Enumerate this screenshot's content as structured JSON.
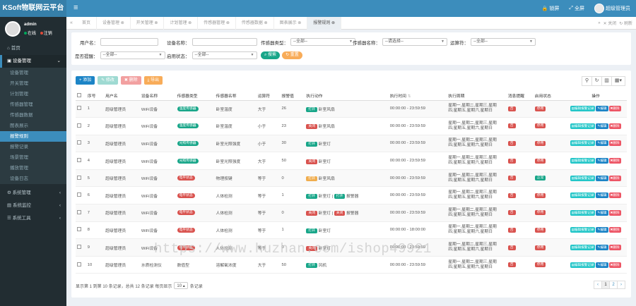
{
  "colors": {
    "brand": "#367fa9",
    "topbar": "#3c8dbc",
    "sidebar": "#222d32",
    "success": "#00a65a",
    "danger": "#dd4b39",
    "warning": "#f39c12",
    "info": "#00c0ef",
    "primary": "#3c8dbc",
    "teal": "#26a69a",
    "pill_green": "#18a689",
    "pill_red": "#d9534f",
    "pill_orange": "#f0ad4e",
    "cyan_btn": "#23c6c8",
    "blue_btn": "#1c84c6"
  },
  "header": {
    "app_title": "KSoft物联网云平台",
    "lock": "锁屏",
    "fullscreen": "全屏",
    "user": "超级管理员"
  },
  "user": {
    "name": "admin",
    "online": "在线",
    "logout": "注销"
  },
  "sidebar": {
    "home": "首页",
    "device_mgmt": "设备管理",
    "sub_items": [
      "设备管理",
      "开关管理",
      "计划管理",
      "传感器管理",
      "传感器数据",
      "图表展示",
      "报警规则",
      "报警记录",
      "场景管理",
      "播放管理",
      "设备日志"
    ],
    "groups": [
      "系统管理",
      "系统监控",
      "系统工具"
    ]
  },
  "tabs": [
    "首页",
    "设备管理",
    "开关管理",
    "计划管理",
    "传感器管理",
    "传感器数据",
    "图表展示",
    "报警规则"
  ],
  "tab_right": {
    "close": "关闭",
    "refresh": "刷新"
  },
  "search": {
    "user_label": "用户名：",
    "device_label": "设备名称：",
    "sensor_type_label": "传感器类型：",
    "sensor_name_label": "传感器名称：",
    "operator_label": "运算符：",
    "notify_label": "是否提醒：",
    "rule_status_label": "启用状态：",
    "all_option": "--全部--",
    "select_option": "--请选择--",
    "search_btn": "搜索",
    "reset_btn": "重置"
  },
  "toolbar": {
    "add": "添加",
    "edit": "修改",
    "delete": "删除",
    "export": "导出"
  },
  "table": {
    "headers": [
      "序号",
      "用户名",
      "设备名称",
      "传感器类型",
      "传感器名称",
      "运算符",
      "报警值",
      "执行动作",
      "执行时间",
      "执行周期",
      "消息提醒",
      "启用状态",
      "操作"
    ],
    "rows": [
      {
        "no": "1",
        "user": "超级管理员",
        "device": "WiFi设备",
        "type": "温度传感器",
        "type_color": "#18a689",
        "sensor": "卧室温度",
        "op": "大于",
        "value": "26",
        "actions": [
          {
            "s": "打开",
            "c": "#18a689",
            "t": "卧室风扇"
          }
        ],
        "time": "00:00:00 - 23:59:59",
        "cycle": "星期一,星期二,星期三,星期四,星期五,星期六,星期日",
        "notify": "否",
        "notify_color": "#d9534f",
        "status": "停用",
        "status_color": "#d9534f"
      },
      {
        "no": "2",
        "user": "超级管理员",
        "device": "WiFi设备",
        "type": "温度传感器",
        "type_color": "#18a689",
        "sensor": "卧室温度",
        "op": "小于",
        "value": "23",
        "actions": [
          {
            "s": "关闭",
            "c": "#d9534f",
            "t": "卧室风扇"
          }
        ],
        "time": "00:00:00 - 23:59:59",
        "cycle": "星期一,星期二,星期三,星期四,星期五,星期六,星期日",
        "notify": "否",
        "notify_color": "#d9534f",
        "status": "停用",
        "status_color": "#d9534f"
      },
      {
        "no": "3",
        "user": "超级管理员",
        "device": "WiFi设备",
        "type": "光照传感器",
        "type_color": "#18a689",
        "sensor": "卧室光照强度",
        "op": "小于",
        "value": "30",
        "actions": [
          {
            "s": "打开",
            "c": "#18a689",
            "t": "卧室灯"
          }
        ],
        "time": "00:00:00 - 23:59:59",
        "cycle": "星期一,星期二,星期三,星期四,星期五,星期六,星期日",
        "notify": "否",
        "notify_color": "#d9534f",
        "status": "停用",
        "status_color": "#d9534f"
      },
      {
        "no": "4",
        "user": "超级管理员",
        "device": "WiFi设备",
        "type": "光照传感器",
        "type_color": "#18a689",
        "sensor": "卧室光照强度",
        "op": "大于",
        "value": "50",
        "actions": [
          {
            "s": "关闭",
            "c": "#d9534f",
            "t": "卧室灯"
          }
        ],
        "time": "00:00:00 - 23:59:59",
        "cycle": "星期一,星期二,星期三,星期四,星期五,星期六,星期日",
        "notify": "否",
        "notify_color": "#d9534f",
        "status": "停用",
        "status_color": "#d9534f"
      },
      {
        "no": "5",
        "user": "超级管理员",
        "device": "WiFi设备",
        "type": "电平状态",
        "type_color": "#d9534f",
        "sensor": "物理按键",
        "op": "等于",
        "value": "0",
        "actions": [
          {
            "s": "打开",
            "c": "#f0ad4e",
            "t": "卧室风扇"
          }
        ],
        "time": "00:00:00 - 23:59:59",
        "cycle": "星期一,星期二,星期三,星期四,星期五,星期六,星期日",
        "notify": "否",
        "notify_color": "#d9534f",
        "status": "正常",
        "status_color": "#18a689"
      },
      {
        "no": "6",
        "user": "超级管理员",
        "device": "WiFi设备",
        "type": "电平状态",
        "type_color": "#d9534f",
        "sensor": "人体检测",
        "op": "等于",
        "value": "1",
        "actions": [
          {
            "s": "打开",
            "c": "#18a689",
            "t": "卧室灯 |"
          },
          {
            "s": "打开",
            "c": "#18a689",
            "t": "报警器"
          }
        ],
        "time": "00:00:00 - 23:59:59",
        "cycle": "星期一,星期二,星期三,星期四,星期五,星期六,星期日",
        "notify": "否",
        "notify_color": "#d9534f",
        "status": "停用",
        "status_color": "#d9534f"
      },
      {
        "no": "7",
        "user": "超级管理员",
        "device": "WiFi设备",
        "type": "电平状态",
        "type_color": "#d9534f",
        "sensor": "人体检测",
        "op": "等于",
        "value": "0",
        "actions": [
          {
            "s": "关闭",
            "c": "#d9534f",
            "t": "卧室灯 |"
          },
          {
            "s": "关闭",
            "c": "#d9534f",
            "t": "报警器"
          }
        ],
        "time": "00:00:00 - 23:59:59",
        "cycle": "星期一,星期二,星期三,星期四,星期五,星期六,星期日",
        "notify": "否",
        "notify_color": "#d9534f",
        "status": "停用",
        "status_color": "#d9534f"
      },
      {
        "no": "8",
        "user": "超级管理员",
        "device": "WiFi设备",
        "type": "电平状态",
        "type_color": "#d9534f",
        "sensor": "人体检测",
        "op": "等于",
        "value": "1",
        "actions": [
          {
            "s": "打开",
            "c": "#18a689",
            "t": "卧室灯"
          }
        ],
        "time": "00:00:00 - 18:00:00",
        "cycle": "星期一,星期二,星期三,星期四,星期五,星期六,星期日",
        "notify": "否",
        "notify_color": "#d9534f",
        "status": "停用",
        "status_color": "#d9534f"
      },
      {
        "no": "9",
        "user": "超级管理员",
        "device": "WiFi设备",
        "type": "电平状态",
        "type_color": "#d9534f",
        "sensor": "人体检测",
        "op": "等于",
        "value": "0",
        "actions": [
          {
            "s": "关闭",
            "c": "#d9534f",
            "t": "卧室灯"
          }
        ],
        "time": "00:00:00 - 23:59:59",
        "cycle": "星期一,星期二,星期三,星期四,星期五,星期六,星期日",
        "notify": "否",
        "notify_color": "#d9534f",
        "status": "停用",
        "status_color": "#d9534f"
      },
      {
        "no": "10",
        "user": "超级管理员",
        "device": "水质检测仪",
        "type": "数值型",
        "type_color": "#ffffff",
        "sensor": "溶解氧浓度",
        "op": "大于",
        "value": "50",
        "actions": [
          {
            "s": "打开",
            "c": "#18a689",
            "t": "风机"
          }
        ],
        "time": "00:00:00 - 23:59:59",
        "cycle": "星期一,星期二,星期三,星期四,星期五,星期六,星期日",
        "notify": "否",
        "notify_color": "#d9534f",
        "status": "停用",
        "status_color": "#d9534f"
      }
    ],
    "ops": {
      "record": "编辑报警记录",
      "edit": "编辑",
      "delete": "删除"
    }
  },
  "footer": {
    "info_prefix": "显示第 1 到第 10 条记录，总共 12 条记录 每页显示",
    "page_size": "10",
    "info_suffix": "条记录",
    "pages": [
      "‹",
      "1",
      "2",
      "›"
    ]
  },
  "watermark": "https://www.huzhan.com/ishop49921"
}
